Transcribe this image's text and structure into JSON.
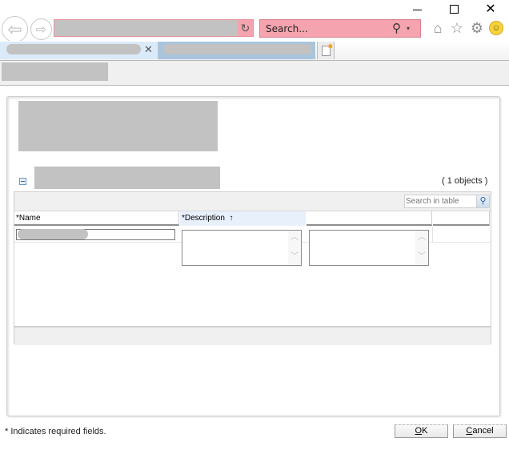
{
  "browser": {
    "window_controls": {
      "minimize": "—",
      "maximize": "",
      "close": "✕"
    },
    "nav": {
      "back_icon": "arrow-left",
      "forward_icon": "arrow-right",
      "refresh_icon": "↻"
    },
    "search": {
      "placeholder": "Search...",
      "icon": "magnifier",
      "dropdown": "▾"
    },
    "toolbar_icons": [
      "home",
      "favorites-star",
      "settings-gear",
      "feedback-smiley"
    ],
    "tab_close": "✕"
  },
  "dialog": {
    "object_count": "( 1 objects )",
    "table": {
      "search_placeholder": "Search in table",
      "columns": [
        {
          "label": "*Name"
        },
        {
          "label": "*Description",
          "sort_indicator": "↑"
        },
        {
          "label": ""
        },
        {
          "label": ""
        }
      ],
      "rows": [
        {
          "name": "",
          "description": "",
          "col3": ""
        }
      ]
    },
    "footer_note": "* Indicates required fields.",
    "buttons": {
      "ok": {
        "accel": "O",
        "rest": "K"
      },
      "cancel": {
        "accel": "C",
        "rest": "ancel"
      }
    }
  }
}
